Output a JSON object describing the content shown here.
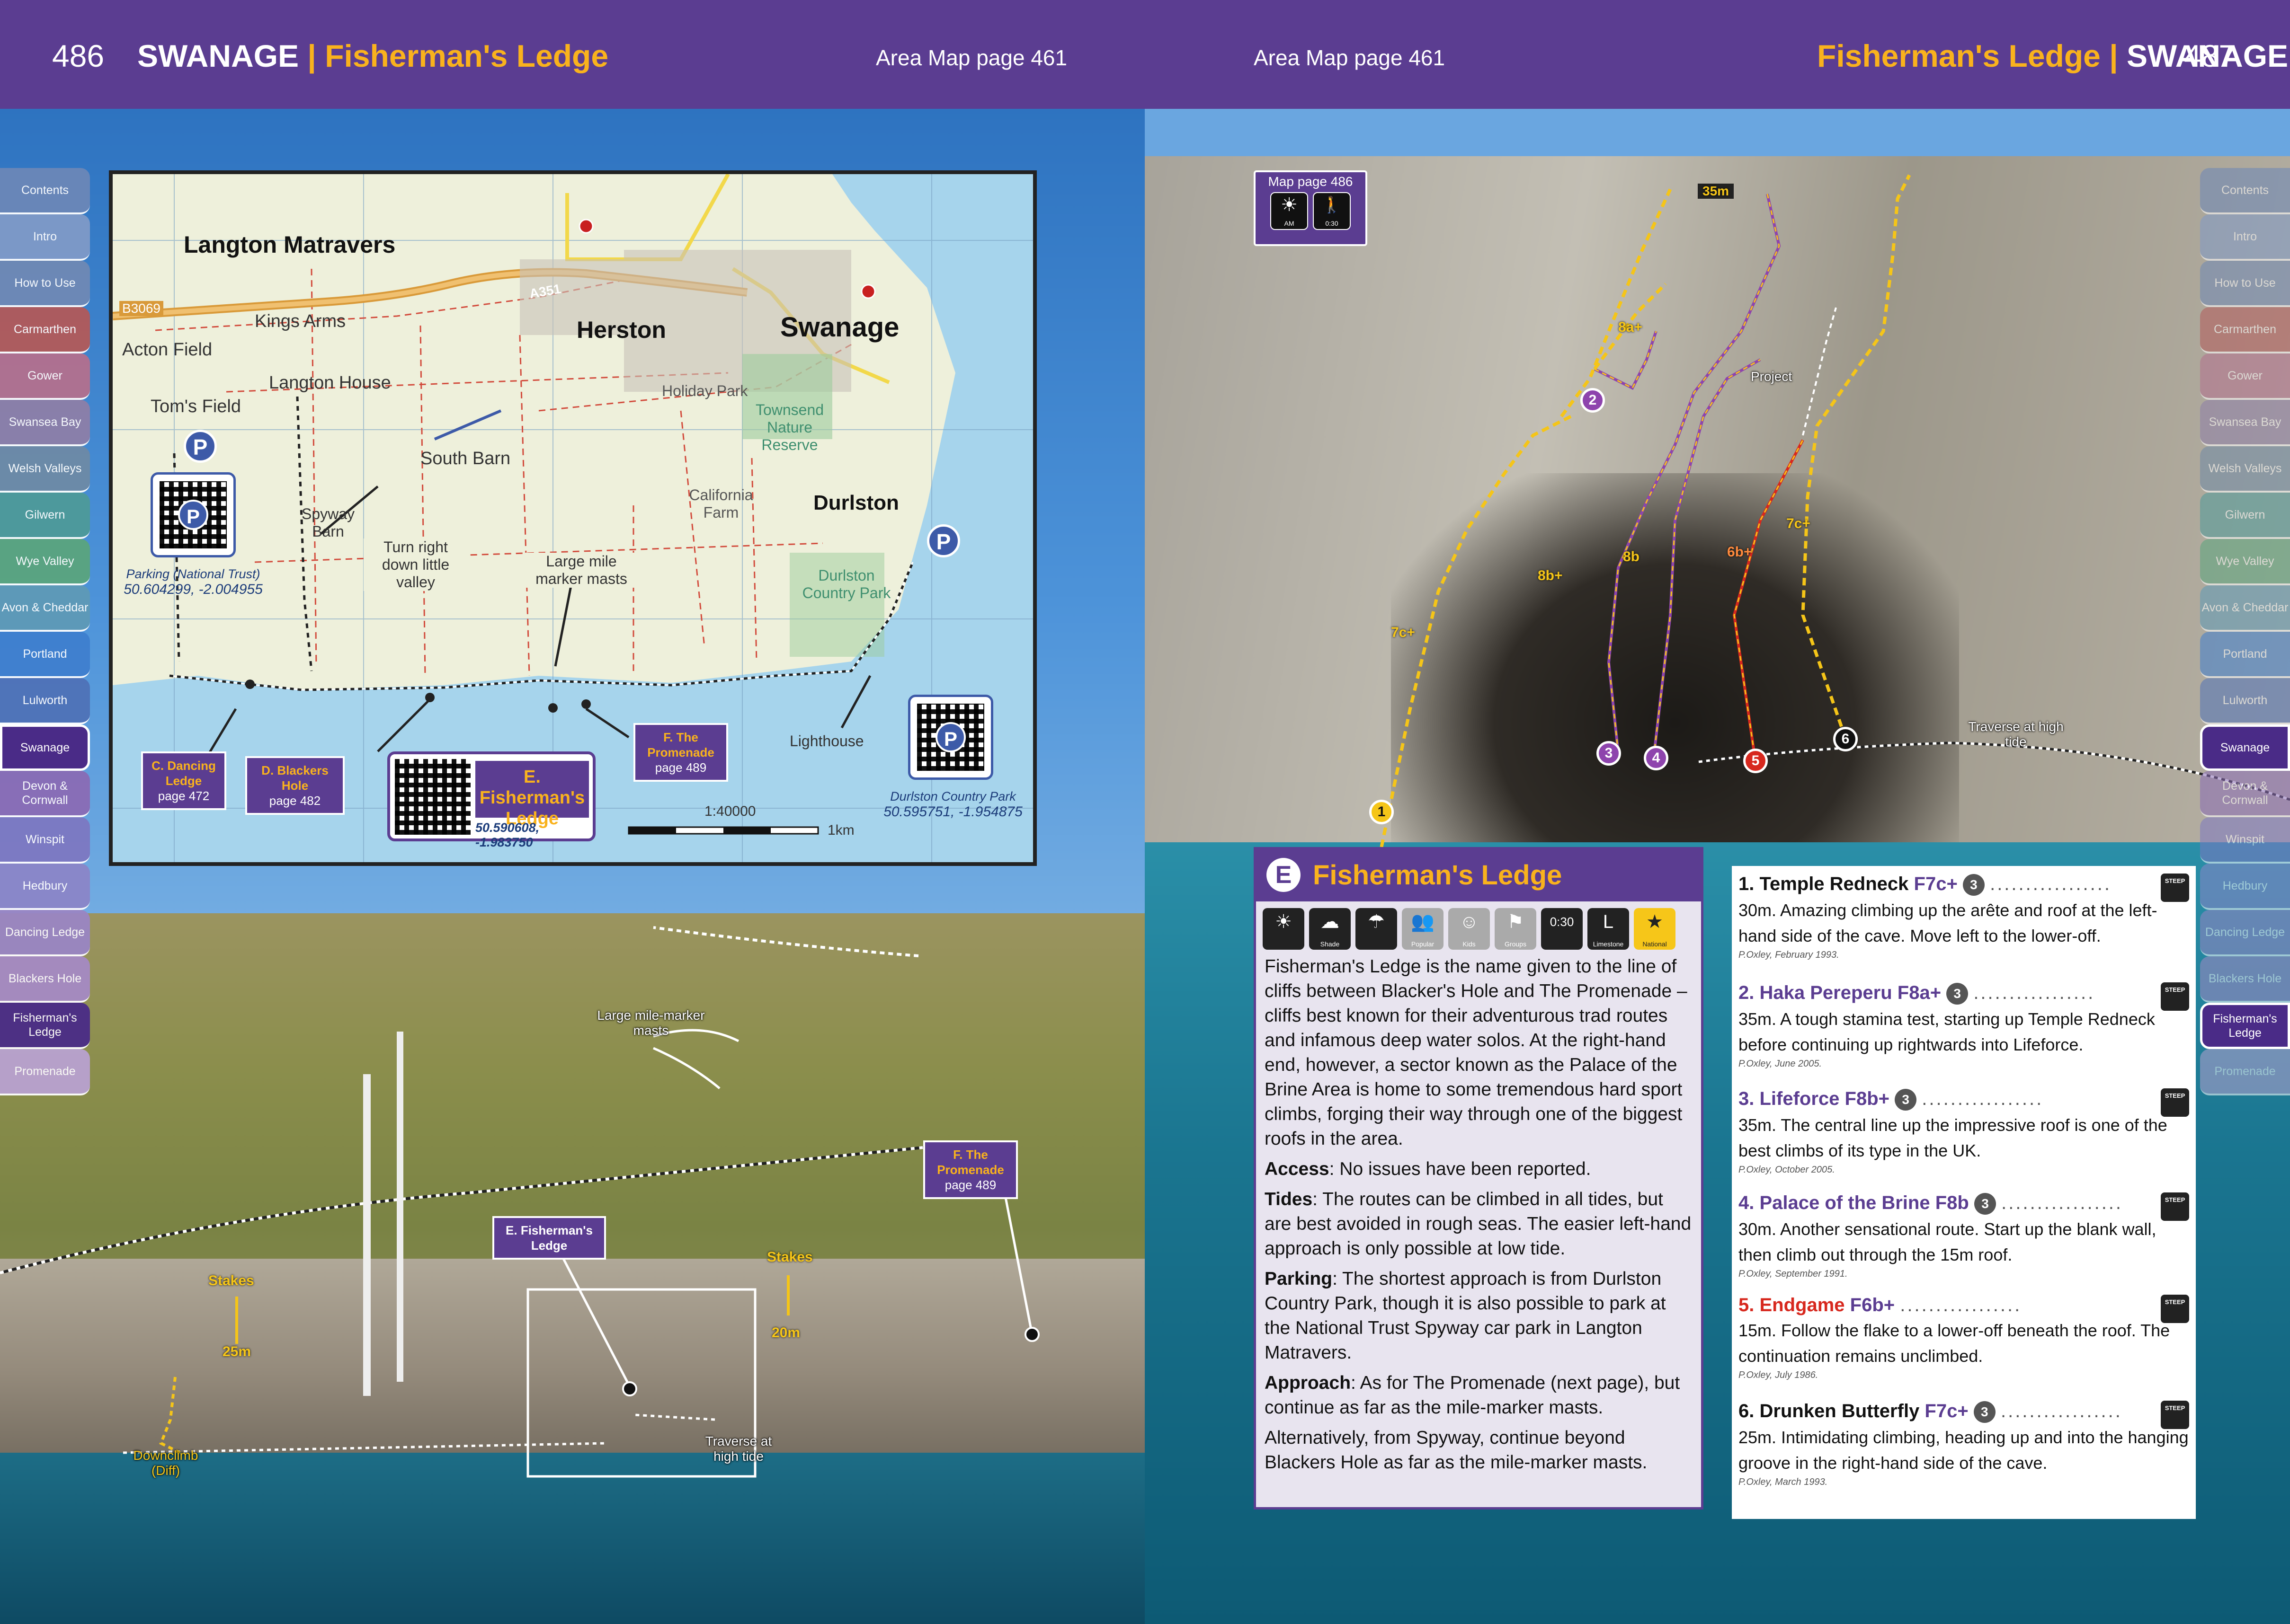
{
  "left": {
    "page_number": "486",
    "area": "SWANAGE",
    "crag": "Fisherman's Ledge",
    "area_map_ref": "Area Map page 461"
  },
  "right": {
    "page_number": "487",
    "area": "SWANAGE",
    "crag": "Fisherman's Ledge",
    "area_map_ref": "Area Map page 461"
  },
  "tabs": [
    "Contents",
    "Intro",
    "How to Use",
    "Carmarthen",
    "Gower",
    "Swansea Bay",
    "Welsh Valleys",
    "Gilwern",
    "Wye Valley",
    "Avon & Cheddar",
    "Portland",
    "Lulworth",
    "Swanage",
    "Devon & Cornwall",
    "Winspit",
    "Hedbury",
    "Dancing Ledge",
    "Blackers Hole",
    "Fisherman's Ledge",
    "Promenade"
  ],
  "tab_colors": [
    "#6b87b8",
    "#7f9ac8",
    "#6f89b5",
    "#b25a5a",
    "#b3708e",
    "#8d7fa8",
    "#6e8aa6",
    "#4e9a9a",
    "#5aa57e",
    "#5e9ab7",
    "#3f7fcf",
    "#4f72b8",
    "#4a2b87",
    "#8a6cb5",
    "#7d78c2",
    "#8b86c8",
    "#9a86c4",
    "#a58ac4",
    "#4a2b87",
    "#b9a2d0"
  ],
  "active_tab": "Swanage",
  "map": {
    "places": [
      "Langton Matravers",
      "Kings Arms",
      "Acton Field",
      "Tom's Field",
      "Langton House",
      "Herston",
      "Swanage",
      "Holiday Park",
      "Townsend Nature Reserve",
      "South Barn",
      "California Farm",
      "Durlston",
      "Durlston Country Park",
      "Spyway Barn",
      "Lighthouse"
    ],
    "roads": [
      "B3069",
      "A351"
    ],
    "notes": [
      "Turn right down little valley",
      "Large mile marker masts"
    ],
    "parking_nt": "Parking (National Trust)",
    "parking_nt_coords": "50.604299, -2.004955",
    "parking_dcp": "Durlston Country Park",
    "parking_dcp_coords": "50.595751, -1.954875",
    "crags": [
      {
        "letter": "C.",
        "name": "Dancing Ledge",
        "page": "page 472"
      },
      {
        "letter": "D.",
        "name": "Blackers Hole",
        "page": "page 482"
      },
      {
        "letter": "F.",
        "name": "The Promenade",
        "page": "page 489"
      }
    ],
    "main_crag": {
      "letter": "E.",
      "name": "Fisherman's Ledge",
      "coords": "50.590608, -1.983750"
    },
    "scale": "1:40000",
    "scale_unit": "1km"
  },
  "photo": {
    "masts": "Large mile-marker masts",
    "stakes": "Stakes",
    "stakes_25": "25m",
    "stakes_20": "20m",
    "traverse": "Traverse at high tide",
    "downclimb": "Downclimb (Diff)",
    "crag_label": "E. Fisherman's Ledge",
    "promenade_label": {
      "letter": "F.",
      "name": "The Promenade",
      "page": "page 489"
    }
  },
  "topo": {
    "map_page": "Map page 486",
    "aspect": "AM",
    "approach_time": "0:30",
    "height": "35m",
    "project": "Project",
    "traverse": "Traverse at high tide",
    "grades": [
      "7c+",
      "8b+",
      "8b",
      "6b+",
      "7c+",
      "8a+"
    ]
  },
  "info": {
    "letter": "E",
    "title": "Fisherman's Ledge",
    "icons": [
      {
        "name": "sun",
        "glyph": "☀",
        "label": ""
      },
      {
        "name": "shade",
        "glyph": "☁",
        "label": "Shade"
      },
      {
        "name": "rain",
        "glyph": "☂",
        "label": ""
      },
      {
        "name": "popular",
        "glyph": "👥",
        "label": "Popular"
      },
      {
        "name": "kids",
        "glyph": "☺",
        "label": "Kids"
      },
      {
        "name": "groups",
        "glyph": "⚑",
        "label": "Groups"
      },
      {
        "name": "walk",
        "glyph": "0:30",
        "label": ""
      },
      {
        "name": "limestone",
        "glyph": "L",
        "label": "Limestone"
      },
      {
        "name": "national",
        "glyph": "★",
        "label": "National"
      }
    ],
    "intro": "Fisherman's Ledge is the name given to the line of cliffs between Blacker's Hole and The Promenade – cliffs best known for their adventurous trad routes and infamous deep water solos. At the right-hand end, however, a sector known as the Palace of the Brine Area is home to some tremendous hard sport climbs, forging their way through one of the biggest roofs in the area.",
    "access_label": "Access",
    "access": ": No issues have been reported.",
    "tides_label": "Tides",
    "tides": ": The routes can be climbed in all tides, but are best avoided in rough seas. The easier left-hand approach is only possible at low tide.",
    "parking_label": "Parking",
    "parking": ": The shortest approach is from Durlston Country Park, though it is also possible to park at the National Trust Spyway car park in Langton Matravers.",
    "approach_label": "Approach",
    "approach": ": As for The Promenade (next page), but continue as far as the mile-marker masts.",
    "approach2": "Alternatively, from Spyway, continue beyond Blackers Hole as far as the mile-marker masts."
  },
  "routes": [
    {
      "num": "1.",
      "name": "Temple Redneck",
      "grade": "F7c+",
      "stars": "3",
      "desc": "30m. Amazing climbing up the arête and roof at the left-hand side of the cave. Move left to the lower-off.",
      "fa": "P.Oxley, February 1993.",
      "color": "black"
    },
    {
      "num": "2.",
      "name": "Haka Pereperu",
      "grade": "F8a+",
      "stars": "3",
      "desc": "35m. A tough stamina test, starting up Temple Redneck before continuing up rightwards into Lifeforce.",
      "fa": "P.Oxley, June 2005.",
      "color": "purple"
    },
    {
      "num": "3.",
      "name": "Lifeforce",
      "grade": "F8b+",
      "stars": "3",
      "desc": "35m. The central line up the impressive roof is one of the best climbs of its type in the UK.",
      "fa": "P.Oxley, October 2005.",
      "color": "purple"
    },
    {
      "num": "4.",
      "name": "Palace of the Brine",
      "grade": "F8b",
      "stars": "3",
      "desc": "30m. Another sensational route. Start up the blank wall, then climb out through the 15m roof.",
      "fa": "P.Oxley, September 1991.",
      "color": "purple"
    },
    {
      "num": "5.",
      "name": "Endgame",
      "grade": "F6b+",
      "stars": "",
      "desc": "15m. Follow the flake to a lower-off beneath the roof. The continuation remains unclimbed.",
      "fa": "P.Oxley, July 1986.",
      "color": "red"
    },
    {
      "num": "6.",
      "name": "Drunken Butterfly",
      "grade": "F7c+",
      "stars": "3",
      "desc": "25m. Intimidating climbing, heading up and into the hanging groove in the right-hand side of the cave.",
      "fa": "P.Oxley, March 1993.",
      "color": "black"
    }
  ],
  "steep_label": "STEEP",
  "dots": "................."
}
